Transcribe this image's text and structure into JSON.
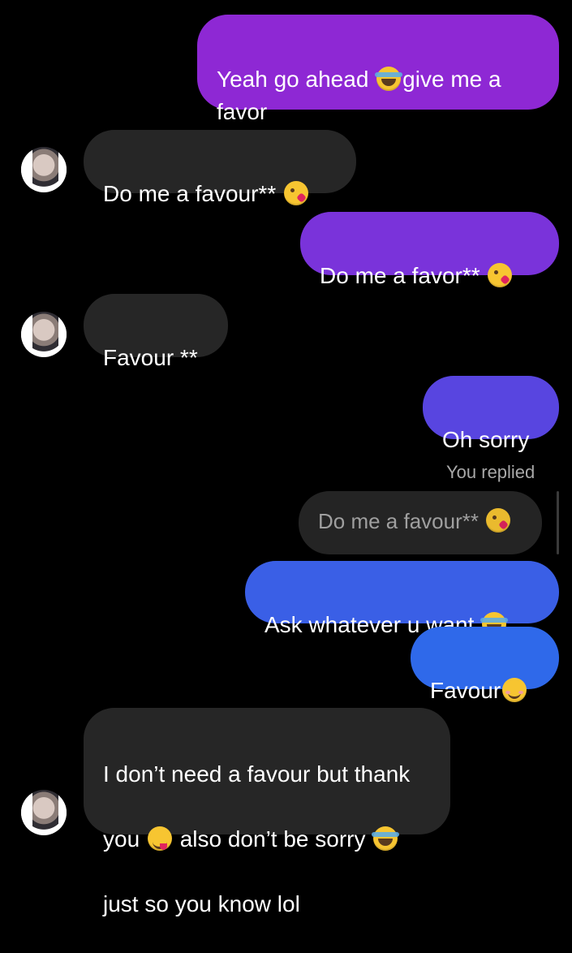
{
  "colors": {
    "background": "#000000",
    "incoming_bubble": "#262626",
    "outgoing_gradient_top": "#8f2ad6",
    "outgoing_gradient_mid": "#6a3be0",
    "outgoing_gradient_bottom": "#2f63e8",
    "reply_label": "#a8a8a8"
  },
  "messages": [
    {
      "direction": "outgoing",
      "parts": [
        "Yeah go ahead ",
        "give me a\nfavor"
      ],
      "emojis": [
        "face-with-tears-of-joy"
      ]
    },
    {
      "direction": "incoming",
      "text": "Do me a favour** ",
      "emoji": "face-blowing-a-kiss"
    },
    {
      "direction": "outgoing",
      "text": "Do me a favor** ",
      "emoji": "face-blowing-a-kiss"
    },
    {
      "direction": "incoming",
      "text": "Favour **"
    },
    {
      "direction": "outgoing",
      "text": "Oh sorry"
    },
    {
      "direction": "outgoing",
      "reply_label": "You replied",
      "quoted_text": "Do me a favour** ",
      "quoted_emoji": "face-blowing-a-kiss",
      "text": "Ask whatever u want ",
      "emoji": "face-with-tears-of-joy"
    },
    {
      "direction": "outgoing",
      "text": "Favour",
      "emoji": "smiling-face-with-smiling-eyes"
    },
    {
      "direction": "incoming",
      "lines": [
        "I don’t need a favour but thank",
        "you ",
        " also don’t be sorry ",
        "just so you know lol"
      ],
      "emojis": [
        "face-savoring-food",
        "face-with-tears-of-joy"
      ]
    }
  ]
}
